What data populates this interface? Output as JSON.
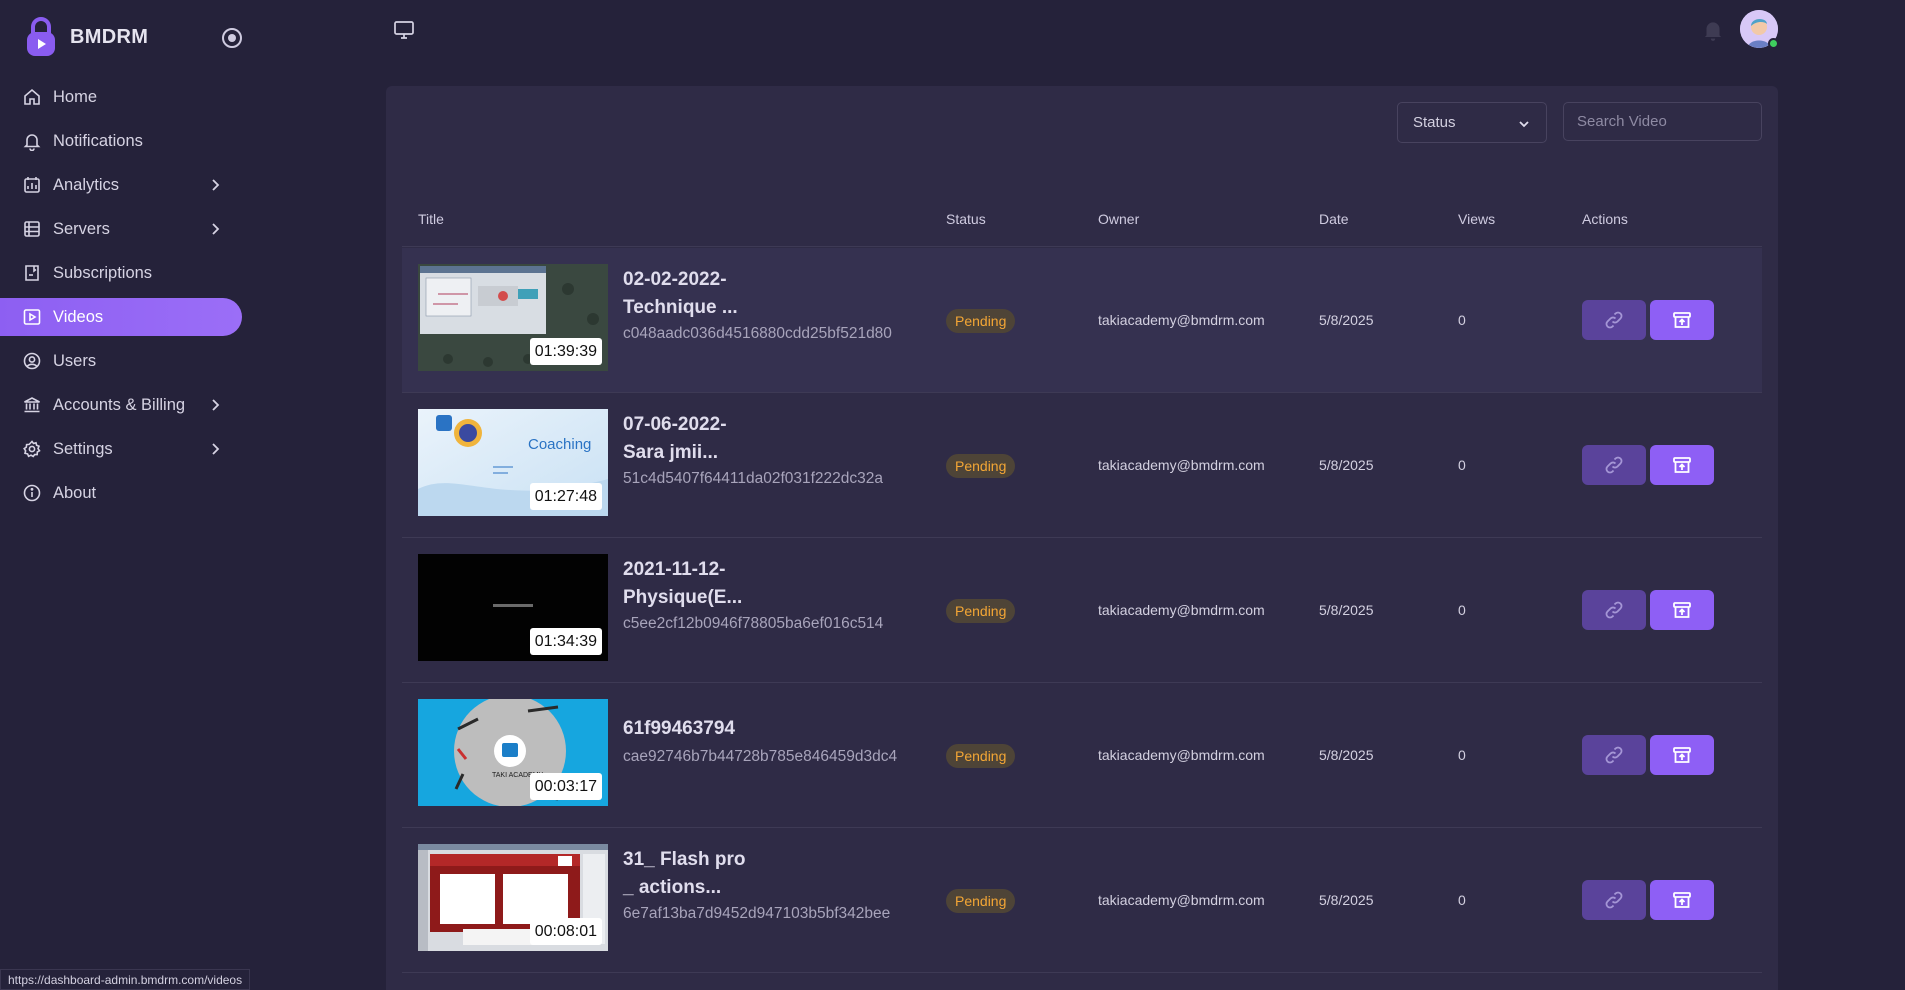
{
  "brand": {
    "name": "BMDRM"
  },
  "sidebar": {
    "items": [
      {
        "label": "Home",
        "icon": "home-icon",
        "active": false,
        "has_children": false
      },
      {
        "label": "Notifications",
        "icon": "bell-icon",
        "active": false,
        "has_children": false
      },
      {
        "label": "Analytics",
        "icon": "analytics-icon",
        "active": false,
        "has_children": true
      },
      {
        "label": "Servers",
        "icon": "server-icon",
        "active": false,
        "has_children": true
      },
      {
        "label": "Subscriptions",
        "icon": "subscription-icon",
        "active": false,
        "has_children": false
      },
      {
        "label": "Videos",
        "icon": "video-icon",
        "active": true,
        "has_children": false
      },
      {
        "label": "Users",
        "icon": "user-icon",
        "active": false,
        "has_children": false
      },
      {
        "label": "Accounts & Billing",
        "icon": "bank-icon",
        "active": false,
        "has_children": true
      },
      {
        "label": "Settings",
        "icon": "gear-icon",
        "active": false,
        "has_children": true
      },
      {
        "label": "About",
        "icon": "info-icon",
        "active": false,
        "has_children": false
      }
    ]
  },
  "filters": {
    "status_label": "Status",
    "search_placeholder": "Search Video"
  },
  "table": {
    "headers": {
      "title": "Title",
      "status": "Status",
      "owner": "Owner",
      "date": "Date",
      "views": "Views",
      "actions": "Actions"
    },
    "rows": [
      {
        "title_line1": "02-02-2022-",
        "title_line2": "Technique ...",
        "hash": "c048aadc036d4516880cdd25bf521d80",
        "duration": "01:39:39",
        "status": "Pending",
        "owner": "takiacademy@bmdrm.com",
        "date": "5/8/2025",
        "views": "0"
      },
      {
        "title_line1": "07-06-2022-",
        "title_line2": "Sara jmii...",
        "hash": "51c4d5407f64411da02f031f222dc32a",
        "duration": "01:27:48",
        "status": "Pending",
        "owner": "takiacademy@bmdrm.com",
        "date": "5/8/2025",
        "views": "0"
      },
      {
        "title_line1": "2021-11-12-",
        "title_line2": "Physique(E...",
        "hash": "c5ee2cf12b0946f78805ba6ef016c514",
        "duration": "01:34:39",
        "status": "Pending",
        "owner": "takiacademy@bmdrm.com",
        "date": "5/8/2025",
        "views": "0"
      },
      {
        "title_line1": "61f99463794",
        "title_line2": "",
        "hash": "cae92746b7b44728b785e846459d3dc4",
        "duration": "00:03:17",
        "status": "Pending",
        "owner": "takiacademy@bmdrm.com",
        "date": "5/8/2025",
        "views": "0"
      },
      {
        "title_line1": "31_ Flash pro",
        "title_line2": "_ actions...",
        "hash": "6e7af13ba7d9452d947103b5bf342bee",
        "duration": "00:08:01",
        "status": "Pending",
        "owner": "takiacademy@bmdrm.com",
        "date": "5/8/2025",
        "views": "0"
      }
    ]
  },
  "thumbnails": {
    "row2_text": "Coaching",
    "row4_text": "TAKI ACADEMY"
  },
  "browser_status": {
    "url": "https://dashboard-admin.bmdrm.com/videos"
  },
  "colors": {
    "accent": "#8e5ff5",
    "background": "#25223a",
    "card": "#2f2b46",
    "pending": "#f3a635"
  }
}
